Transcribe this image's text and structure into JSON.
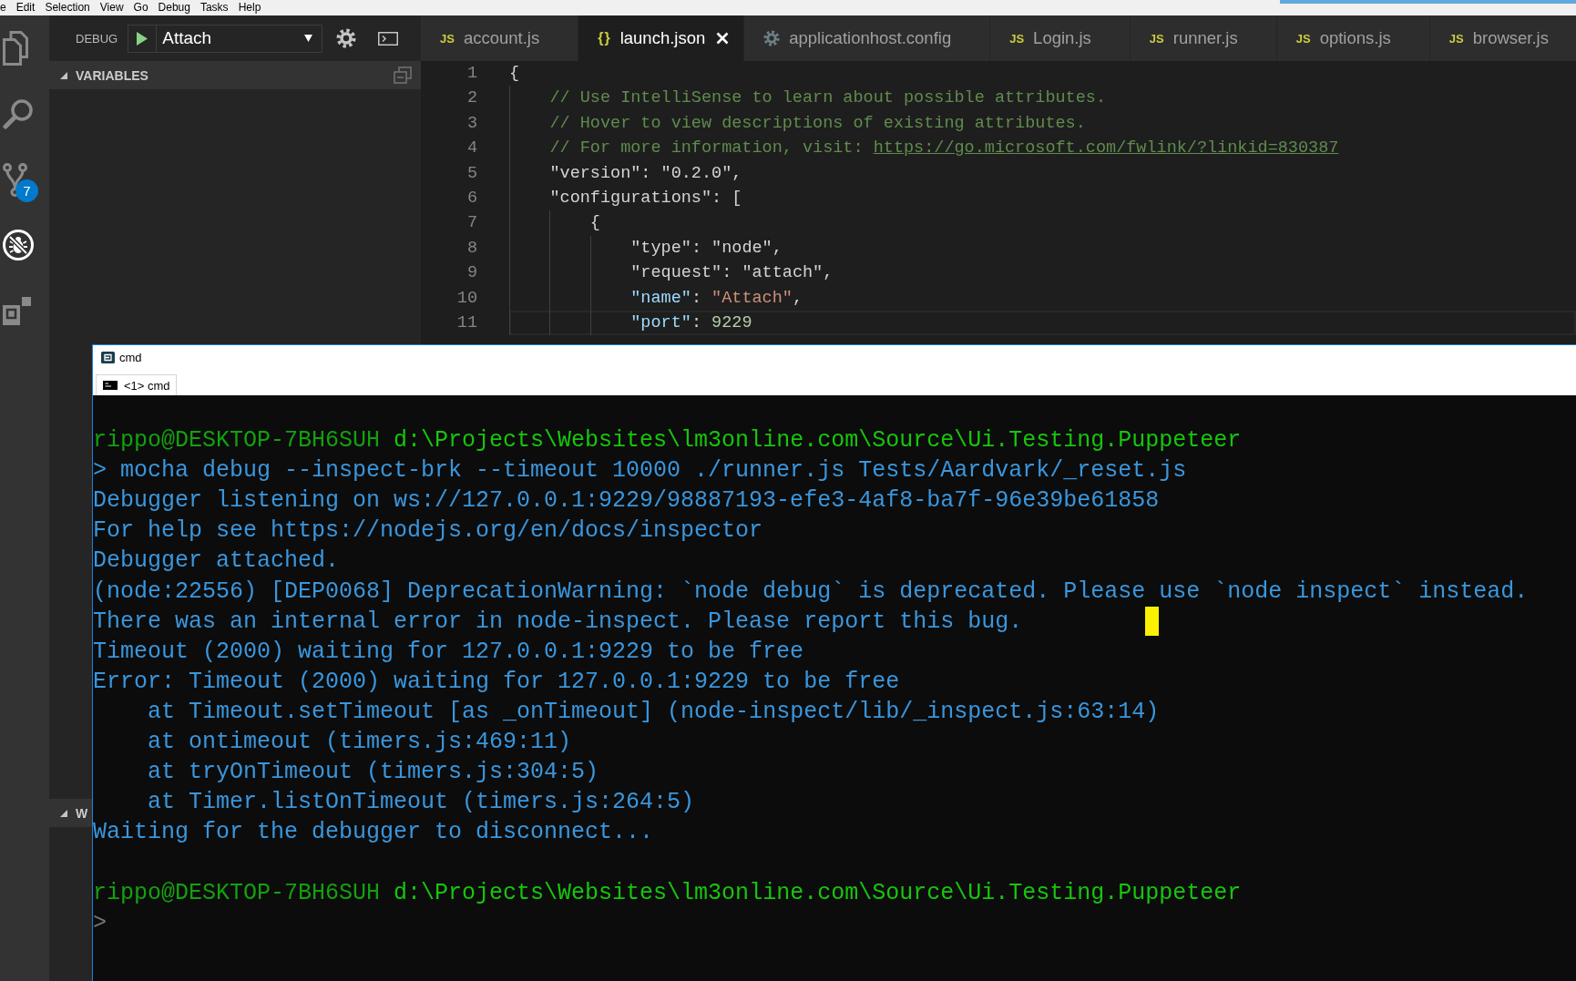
{
  "menu_bar": {
    "items": [
      "e",
      "Edit",
      "Selection",
      "View",
      "Go",
      "Debug",
      "Tasks",
      "Help"
    ]
  },
  "activity_bar": {
    "items": [
      {
        "kind": "files",
        "selected": false
      },
      {
        "kind": "search",
        "selected": false
      },
      {
        "kind": "source-control",
        "selected": false,
        "badge": "7"
      },
      {
        "kind": "debug",
        "selected": true
      },
      {
        "kind": "extensions",
        "selected": false
      }
    ]
  },
  "debug_toolbar": {
    "label": "DEBUG",
    "configuration": "Attach"
  },
  "sidebar": {
    "sections": [
      {
        "title": "VARIABLES",
        "expanded": true,
        "collapse_all": true
      },
      {
        "title": "W",
        "expanded": true,
        "collapse_all": false
      }
    ]
  },
  "editor": {
    "tabs": [
      {
        "kind": "js",
        "icon": "JS",
        "label": "account.js",
        "selected": false
      },
      {
        "kind": "json",
        "icon": "{}",
        "label": "launch.json",
        "selected": true
      },
      {
        "kind": "config",
        "label": "applicationhost.config",
        "selected": false
      },
      {
        "kind": "js",
        "icon": "JS",
        "label": "Login.js",
        "selected": false
      },
      {
        "kind": "js",
        "icon": "JS",
        "label": "runner.js",
        "selected": false
      },
      {
        "kind": "js",
        "icon": "JS",
        "label": "options.js",
        "selected": false
      },
      {
        "kind": "js",
        "icon": "JS",
        "label": "browser.js",
        "selected": false
      }
    ],
    "lines": [
      {
        "number": "1",
        "current": false,
        "tokens": [
          {
            "kind": "plain",
            "text": "{"
          }
        ]
      },
      {
        "number": "2",
        "current": false,
        "tokens": [
          {
            "kind": "comment",
            "text": "    // Use IntelliSense to learn about possible attributes."
          }
        ]
      },
      {
        "number": "3",
        "current": false,
        "tokens": [
          {
            "kind": "comment",
            "text": "    // Hover to view descriptions of existing attributes."
          }
        ]
      },
      {
        "number": "4",
        "current": false,
        "tokens": [
          {
            "kind": "comment",
            "text": "    // For more information, visit: "
          },
          {
            "kind": "link",
            "text": "https://go.microsoft.com/fwlink/?linkid=830387"
          }
        ]
      },
      {
        "number": "5",
        "current": false,
        "tokens": [
          {
            "kind": "plain",
            "text": "    \"version\": \"0.2.0\","
          }
        ]
      },
      {
        "number": "6",
        "current": false,
        "tokens": [
          {
            "kind": "plain",
            "text": "    \"configurations\": ["
          }
        ]
      },
      {
        "number": "7",
        "current": false,
        "tokens": [
          {
            "kind": "plain",
            "text": "        {"
          }
        ]
      },
      {
        "number": "8",
        "current": false,
        "tokens": [
          {
            "kind": "plain",
            "text": "            \"type\": \"node\","
          }
        ]
      },
      {
        "number": "9",
        "current": false,
        "tokens": [
          {
            "kind": "plain",
            "text": "            \"request\": \"attach\","
          }
        ]
      },
      {
        "number": "10",
        "current": false,
        "tokens": [
          {
            "kind": "key",
            "text": "            \"name\""
          },
          {
            "kind": "plain",
            "text": ": "
          },
          {
            "kind": "string",
            "text": "\"Attach\""
          },
          {
            "kind": "plain",
            "text": ","
          }
        ]
      },
      {
        "number": "11",
        "current": true,
        "tokens": [
          {
            "kind": "key",
            "text": "            \"port\""
          },
          {
            "kind": "plain",
            "text": ": "
          },
          {
            "kind": "number",
            "text": "9229"
          }
        ]
      }
    ]
  },
  "terminal_window": {
    "title": "cmd",
    "tabs": [
      {
        "label": "<1> cmd",
        "selected": true
      }
    ],
    "blocks": [
      {
        "lines": [
          {
            "cursor": false,
            "segments": [
              {
                "kind": "user",
                "text": "rippo@DESKTOP-7BH6SUH"
              },
              {
                "kind": "path",
                "text": "d:\\Projects\\Websites\\lm3online.com\\Source\\Ui.Testing.Puppeteer"
              }
            ]
          },
          {
            "cursor": false,
            "segments": [
              {
                "kind": "command",
                "text": "> mocha debug --inspect-brk --timeout 10000 ./runner.js Tests/Aardvark/_reset.js"
              }
            ]
          },
          {
            "cursor": false,
            "segments": [
              {
                "kind": "output",
                "text": "Debugger listening on ws://127.0.0.1:9229/98887193-efe3-4af8-ba7f-96e39be61858"
              }
            ]
          },
          {
            "cursor": false,
            "segments": [
              {
                "kind": "output",
                "text": "For help see https://nodejs.org/en/docs/inspector"
              }
            ]
          },
          {
            "cursor": false,
            "segments": [
              {
                "kind": "output",
                "text": "Debugger attached."
              }
            ]
          },
          {
            "cursor": false,
            "segments": [
              {
                "kind": "output",
                "text": "(node:22556) [DEP0068] DeprecationWarning: `node debug` is deprecated. Please use `node inspect` instead."
              }
            ]
          },
          {
            "cursor": true,
            "segments": [
              {
                "kind": "output",
                "text": "There was an internal error in node-inspect. Please report this bug."
              }
            ]
          },
          {
            "cursor": false,
            "segments": [
              {
                "kind": "output",
                "text": "Timeout (2000) waiting for 127.0.0.1:9229 to be free"
              }
            ]
          },
          {
            "cursor": false,
            "segments": [
              {
                "kind": "output",
                "text": "Error: Timeout (2000) waiting for 127.0.0.1:9229 to be free"
              }
            ]
          },
          {
            "cursor": false,
            "segments": [
              {
                "kind": "output",
                "text": "    at Timeout.setTimeout [as _onTimeout] (node-inspect/lib/_inspect.js:63:14)"
              }
            ]
          },
          {
            "cursor": false,
            "segments": [
              {
                "kind": "output",
                "text": "    at ontimeout (timers.js:469:11)"
              }
            ]
          },
          {
            "cursor": false,
            "segments": [
              {
                "kind": "output",
                "text": "    at tryOnTimeout (timers.js:304:5)"
              }
            ]
          },
          {
            "cursor": false,
            "segments": [
              {
                "kind": "output",
                "text": "    at Timer.listOnTimeout (timers.js:264:5)"
              }
            ]
          },
          {
            "cursor": false,
            "segments": [
              {
                "kind": "output",
                "text": "Waiting for the debugger to disconnect..."
              }
            ]
          }
        ]
      },
      {
        "lines": [
          {
            "cursor": false,
            "segments": [
              {
                "kind": "user",
                "text": "rippo@DESKTOP-7BH6SUH"
              },
              {
                "kind": "path",
                "text": "d:\\Projects\\Websites\\lm3online.com\\Source\\Ui.Testing.Puppeteer"
              }
            ]
          },
          {
            "cursor": false,
            "segments": [
              {
                "kind": "prompt",
                "text": ">"
              }
            ]
          }
        ]
      }
    ]
  }
}
